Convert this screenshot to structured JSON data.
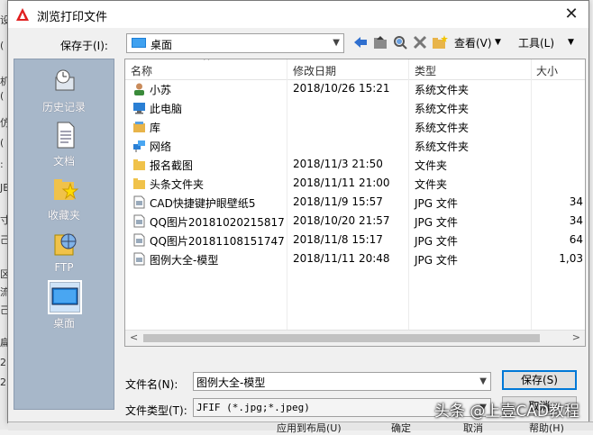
{
  "window": {
    "title": "浏览打印文件"
  },
  "save_in": {
    "label": "保存于(I):",
    "value": "桌面"
  },
  "toolbar": {
    "view_label": "查看(V)",
    "tools_label": "工具(L)"
  },
  "places": [
    {
      "label": "历史记录",
      "icon": "history-icon"
    },
    {
      "label": "文档",
      "icon": "document-icon"
    },
    {
      "label": "收藏夹",
      "icon": "favorites-icon"
    },
    {
      "label": "FTP",
      "icon": "ftp-icon"
    },
    {
      "label": "桌面",
      "icon": "desktop-icon"
    }
  ],
  "columns": [
    "名称",
    "修改日期",
    "类型",
    "大小"
  ],
  "files": [
    {
      "name": "小苏",
      "date": "2018/10/26 15:21",
      "type": "系统文件夹",
      "size": "",
      "icon": "user-folder-icon"
    },
    {
      "name": "此电脑",
      "date": "",
      "type": "系统文件夹",
      "size": "",
      "icon": "computer-icon"
    },
    {
      "name": "库",
      "date": "",
      "type": "系统文件夹",
      "size": "",
      "icon": "library-icon"
    },
    {
      "name": "网络",
      "date": "",
      "type": "系统文件夹",
      "size": "",
      "icon": "network-icon"
    },
    {
      "name": "报名截图",
      "date": "2018/11/3 21:50",
      "type": "文件夹",
      "size": "",
      "icon": "folder-icon"
    },
    {
      "name": "头条文件夹",
      "date": "2018/11/11 21:00",
      "type": "文件夹",
      "size": "",
      "icon": "folder-icon"
    },
    {
      "name": "CAD快捷键护眼壁纸5",
      "date": "2018/11/9 15:57",
      "type": "JPG 文件",
      "size": "34",
      "icon": "jpg-file-icon"
    },
    {
      "name": "QQ图片20181020215817",
      "date": "2018/10/20 21:57",
      "type": "JPG 文件",
      "size": "34",
      "icon": "jpg-file-icon"
    },
    {
      "name": "QQ图片20181108151747",
      "date": "2018/11/8 15:17",
      "type": "JPG 文件",
      "size": "64",
      "icon": "jpg-file-icon"
    },
    {
      "name": "图例大全-模型",
      "date": "2018/11/11 20:48",
      "type": "JPG 文件",
      "size": "1,03",
      "icon": "jpg-file-icon"
    }
  ],
  "filename": {
    "label": "文件名(N):",
    "value": "图例大全-模型"
  },
  "filetype": {
    "label": "文件类型(T):",
    "value": "JFIF (*.jpg;*.jpeg)"
  },
  "buttons": {
    "save": "保存(S)",
    "cancel": "取消"
  },
  "background_bar": [
    "应用到布局(U)",
    "确定",
    "取消",
    "帮助(H)"
  ],
  "watermark": "头条 @上壹CAD教程",
  "colors": {
    "places_bg": "#a7b7c9",
    "accent": "#0078d7"
  }
}
